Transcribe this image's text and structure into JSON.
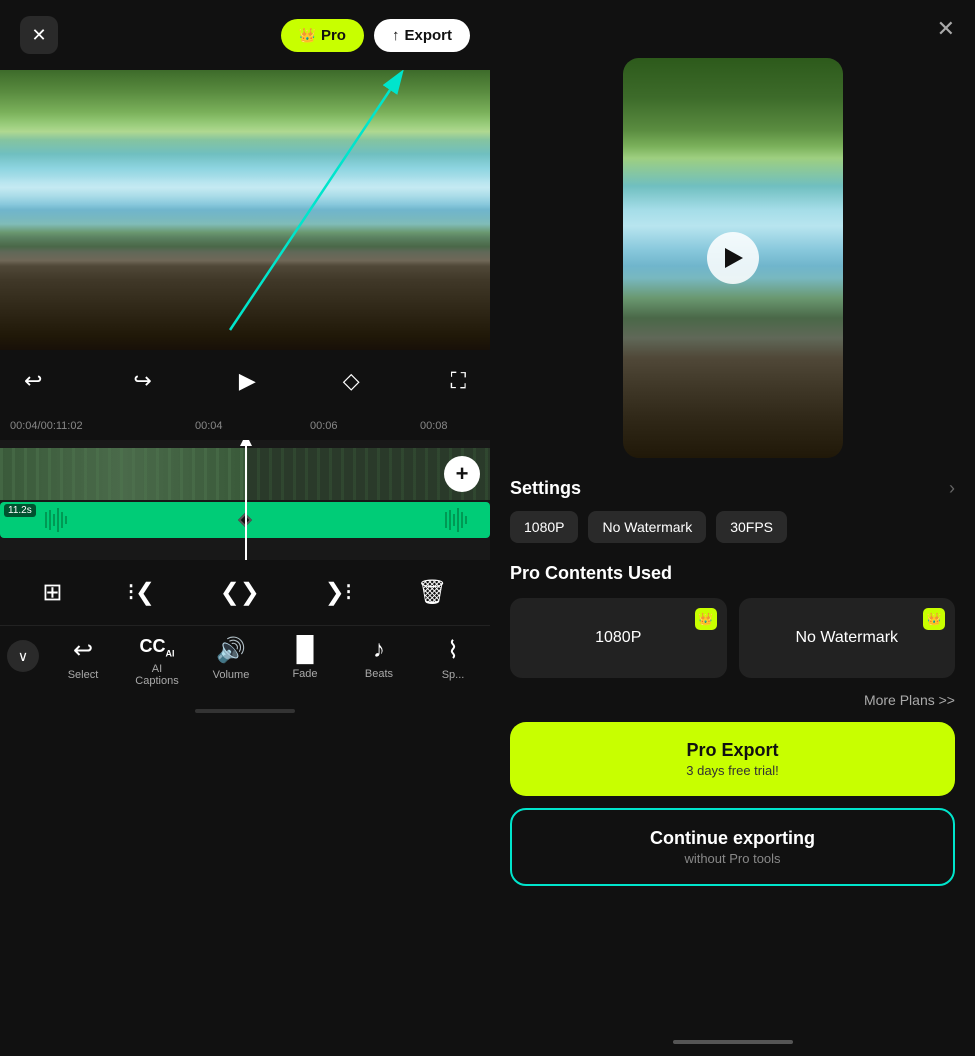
{
  "left": {
    "close_label": "✕",
    "pro_label": "Pro",
    "export_label": "Export",
    "time_current": "00:04",
    "time_total": "00:11:02",
    "time_marks": [
      "00:04",
      "00:06",
      "00:08"
    ],
    "audio_duration": "11.2s",
    "edit_tools": [
      "⊞",
      "⁝⁞",
      "⊞⊟",
      "⊟⊞",
      "🗑"
    ],
    "tools": [
      {
        "name": "Select",
        "icon": "↩"
      },
      {
        "name": "AI Captions",
        "icon": "CC"
      },
      {
        "name": "Volume",
        "icon": "🔊"
      },
      {
        "name": "Fade",
        "icon": "▐"
      },
      {
        "name": "Beats",
        "icon": "♪"
      },
      {
        "name": "Sp...",
        "icon": "⌇"
      }
    ]
  },
  "right": {
    "close_label": "✕",
    "settings_title": "Settings",
    "settings_pills": [
      "1080P",
      "No Watermark",
      "30FPS"
    ],
    "pro_contents_title": "Pro Contents Used",
    "pro_cards": [
      {
        "label": "1080P"
      },
      {
        "label": "No Watermark"
      }
    ],
    "more_plans": "More Plans >>",
    "pro_export_title": "Pro Export",
    "pro_export_sub": "3 days free trial!",
    "continue_title": "Continue exporting",
    "continue_sub": "without Pro tools"
  }
}
